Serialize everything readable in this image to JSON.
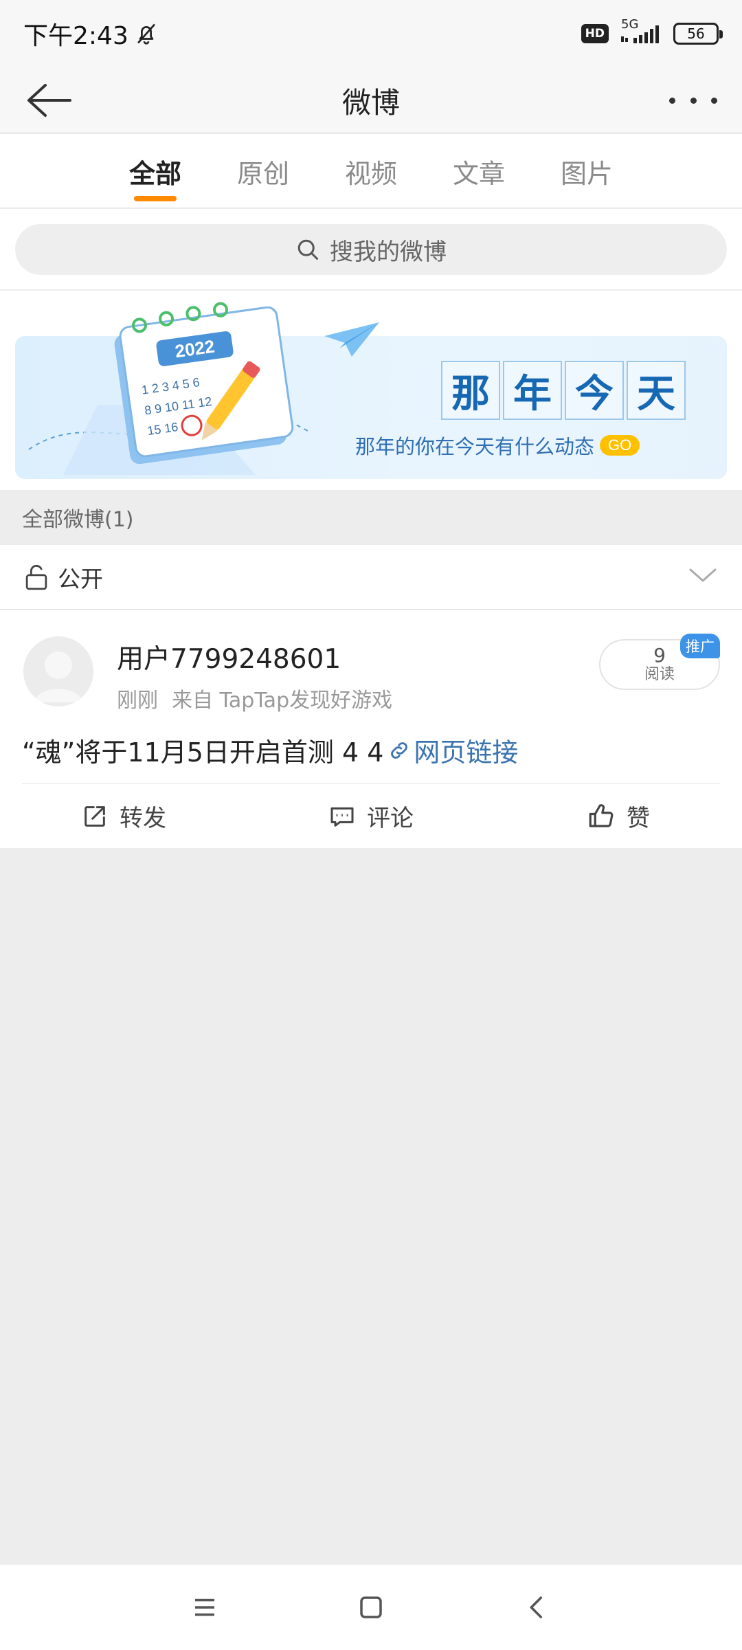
{
  "status_bar": {
    "time": "下午2:43",
    "hd": "HD",
    "network": "5G",
    "battery": "56"
  },
  "nav": {
    "title": "微博"
  },
  "tabs": [
    {
      "label": "全部",
      "active": true
    },
    {
      "label": "原创",
      "active": false
    },
    {
      "label": "视频",
      "active": false
    },
    {
      "label": "文章",
      "active": false
    },
    {
      "label": "图片",
      "active": false
    }
  ],
  "search": {
    "placeholder": "搜我的微博"
  },
  "banner": {
    "calendar_year": "2022",
    "title_chars": [
      "那",
      "年",
      "今",
      "天"
    ],
    "subtitle": "那年的你在今天有什么动态",
    "go_label": "GO"
  },
  "section": {
    "header": "全部微博(1)"
  },
  "filter": {
    "label": "公开"
  },
  "post": {
    "username": "用户7799248601",
    "time": "刚刚",
    "source": "来自 TapTap发现好游戏",
    "read_count": "9",
    "read_label": "阅读",
    "promo_badge": "推广",
    "text": "“魂”将于11月5日开启首测 4 4",
    "link_label": "网页链接",
    "actions": {
      "repost": "转发",
      "comment": "评论",
      "like": "赞"
    }
  },
  "colors": {
    "accent_tab": "#ff8a00",
    "link": "#3a74b0",
    "promo": "#3c93e8",
    "banner_title": "#1768b3"
  }
}
